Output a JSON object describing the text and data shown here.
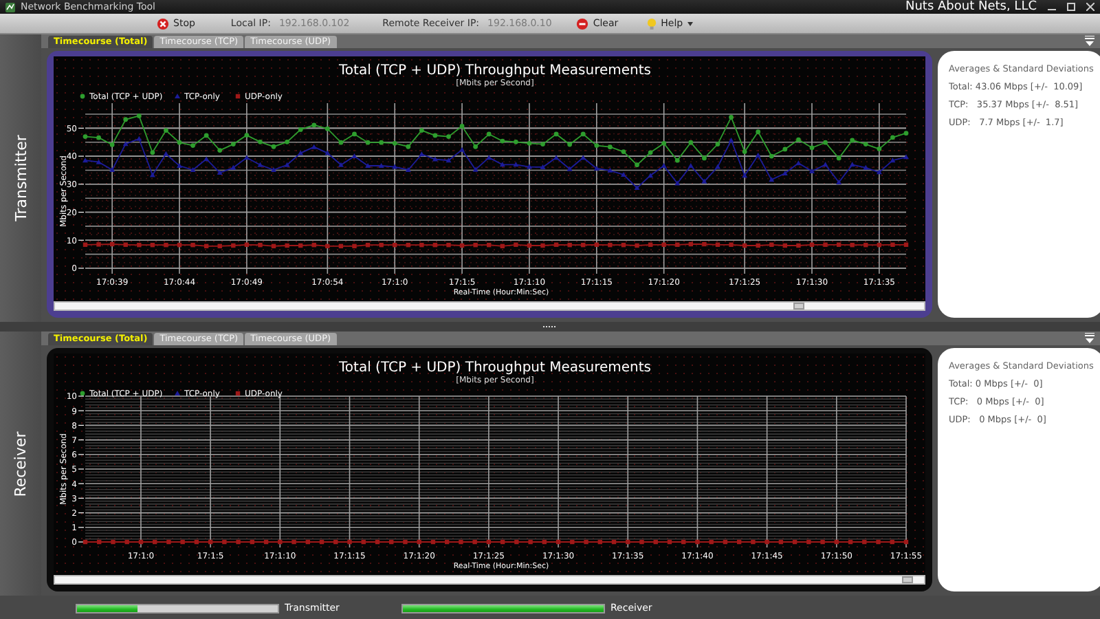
{
  "window": {
    "title": "Network Benchmarking Tool",
    "company": "Nuts About Nets, LLC"
  },
  "toolbar": [
    {
      "kind": "stop",
      "label": "Stop"
    },
    {
      "kind": "label",
      "label": "Local IP:"
    },
    {
      "kind": "value",
      "label": "192.168.0.102"
    },
    {
      "kind": "label",
      "label": "Remote Receiver IP:"
    },
    {
      "kind": "value",
      "label": "192.168.0.10"
    },
    {
      "kind": "clear",
      "label": "Clear"
    },
    {
      "kind": "help",
      "label": "Help"
    }
  ],
  "panels": [
    {
      "name": "Transmitter",
      "selected": true,
      "tabs": [
        {
          "label": "Timecourse (Total)",
          "selected": true
        },
        {
          "label": "Timecourse (TCP)",
          "selected": false
        },
        {
          "label": "Timecourse (UDP)",
          "selected": false
        }
      ],
      "chart_subtitle": "[Mbits per Second]",
      "chart_data": {
        "type": "line",
        "title": "Total (TCP + UDP) Throughput Measurements",
        "xlabel": "Real-Time (Hour:Min:Sec)",
        "ylabel": "Mbits per Second",
        "categories": [
          null,
          null,
          "17:0:39",
          null,
          null,
          null,
          null,
          "17:0:44",
          null,
          null,
          null,
          null,
          "17:0:49",
          null,
          null,
          null,
          null,
          null,
          "17:0:54",
          null,
          null,
          null,
          null,
          "17:1:0",
          null,
          null,
          null,
          null,
          "17:1:5",
          null,
          null,
          null,
          null,
          "17:1:10",
          null,
          null,
          null,
          null,
          "17:1:15",
          null,
          null,
          null,
          null,
          "17:1:20",
          null,
          null,
          null,
          null,
          null,
          "17:1:25",
          null,
          null,
          null,
          null,
          "17:1:30",
          null,
          null,
          null,
          null,
          "17:1:35",
          null,
          null
        ],
        "ylim": [
          0,
          55
        ],
        "grid": true,
        "legend": true,
        "yticks": [
          0,
          10,
          20,
          30,
          40,
          50
        ],
        "series": [
          {
            "name": "Total (TCP + UDP)",
            "color": "#2e9e2e",
            "marker": "circle",
            "values": [
              47.0,
              46.6,
              44.1,
              53.1,
              54.4,
              41.3,
              49.2,
              44.9,
              43.8,
              47.4,
              42.1,
              44.3,
              47.5,
              45.1,
              43.4,
              45.1,
              49.5,
              51.1,
              49.8,
              44.9,
              47.9,
              44.9,
              44.9,
              44.6,
              43.4,
              49.2,
              47.4,
              47.0,
              50.7,
              43.4,
              47.9,
              45.4,
              45.1,
              44.6,
              44.3,
              47.9,
              44.2,
              47.9,
              43.8,
              43.3,
              41.6,
              36.9,
              41.3,
              44.6,
              38.5,
              44.9,
              39.3,
              44.3,
              53.9,
              41.6,
              48.7,
              40.0,
              42.5,
              45.9,
              43.0,
              44.9,
              39.3,
              45.7,
              44.3,
              42.6,
              46.7,
              48.2
            ]
          },
          {
            "name": "TCP-only",
            "color": "#1c1c9a",
            "marker": "triangle",
            "values": [
              38.5,
              37.9,
              35.1,
              44.4,
              46.2,
              33.3,
              40.8,
              36.6,
              35.1,
              39.0,
              34.1,
              35.9,
              39.5,
              36.9,
              35.1,
              36.9,
              41.1,
              43.3,
              41.1,
              36.9,
              40.0,
              36.6,
              36.6,
              36.2,
              35.1,
              40.7,
              38.9,
              38.5,
              42.3,
              35.2,
              39.5,
              37.0,
              37.0,
              36.2,
              36.1,
              39.5,
              35.4,
              39.5,
              35.6,
              34.9,
              33.4,
              28.7,
              33.1,
              36.6,
              30.3,
              36.6,
              31.0,
              36.2,
              45.7,
              33.1,
              40.3,
              31.6,
              33.9,
              37.5,
              34.6,
              37.0,
              30.7,
              37.0,
              35.9,
              34.3,
              38.5,
              39.7
            ]
          },
          {
            "name": "UDP-only",
            "color": "#a01818",
            "marker": "square",
            "values": [
              8.4,
              8.5,
              8.6,
              8.4,
              8.3,
              8.3,
              8.3,
              8.3,
              8.3,
              7.9,
              7.9,
              8.1,
              8.4,
              8.3,
              7.9,
              8.1,
              8.1,
              8.3,
              7.9,
              7.9,
              7.9,
              8.3,
              8.3,
              8.3,
              8.3,
              8.3,
              8.3,
              8.3,
              8.1,
              8.3,
              8.3,
              7.9,
              8.4,
              8.1,
              8.1,
              8.4,
              8.3,
              8.3,
              8.4,
              8.3,
              8.3,
              8.1,
              8.4,
              8.4,
              8.4,
              8.6,
              8.6,
              8.4,
              8.4,
              8.1,
              8.1,
              8.4,
              8.1,
              8.1,
              8.4,
              8.4,
              8.4,
              8.3,
              8.3,
              8.3,
              8.4,
              8.4
            ]
          }
        ]
      },
      "stats": {
        "title": "Averages & Standard Deviations",
        "lines": [
          "Total: 43.06 Mbps [+/-  10.09]",
          "TCP:   35.37 Mbps [+/-  8.51]",
          "UDP:   7.7 Mbps [+/-  1.7]"
        ]
      }
    },
    {
      "name": "Receiver",
      "selected": false,
      "tabs": [
        {
          "label": "Timecourse (Total)",
          "selected": true
        },
        {
          "label": "Timecourse (TCP)",
          "selected": false
        },
        {
          "label": "Timecourse (UDP)",
          "selected": false
        }
      ],
      "chart_subtitle": "[Mbits per Second]",
      "chart_data": {
        "type": "line",
        "title": "Total (TCP + UDP) Throughput Measurements",
        "xlabel": "Real-Time (Hour:Min:Sec)",
        "ylabel": "Mbits per Second",
        "categories": [
          null,
          null,
          null,
          null,
          "17:1:0",
          null,
          null,
          null,
          null,
          "17:1:5",
          null,
          null,
          null,
          null,
          "17:1:10",
          null,
          null,
          null,
          null,
          "17:1:15",
          null,
          null,
          null,
          null,
          "17:1:20",
          null,
          null,
          null,
          null,
          "17:1:25",
          null,
          null,
          null,
          null,
          "17:1:30",
          null,
          null,
          null,
          null,
          "17:1:35",
          null,
          null,
          null,
          null,
          "17:1:40",
          null,
          null,
          null,
          null,
          "17:1:45",
          null,
          null,
          null,
          null,
          "17:1:50",
          null,
          null,
          null,
          null,
          "17:1:55"
        ],
        "ylim": [
          0,
          10
        ],
        "grid": true,
        "legend": true,
        "yticks": [
          0,
          1,
          2,
          3,
          4,
          5,
          6,
          7,
          8,
          9,
          10
        ],
        "series": [
          {
            "name": "Total (TCP + UDP)",
            "color": "#2e9e2e",
            "marker": "circle",
            "values": [
              null,
              null,
              null,
              null,
              null,
              null,
              null,
              null,
              null,
              null,
              null,
              null,
              null,
              null,
              null,
              null,
              null,
              null,
              null,
              null,
              null,
              null,
              null,
              null,
              null,
              null,
              null,
              null,
              null,
              null,
              null,
              null,
              null,
              null,
              null,
              null,
              null,
              null,
              null,
              null,
              null,
              null,
              null,
              null,
              null,
              null,
              null,
              null,
              null,
              null,
              null,
              null,
              null,
              null,
              null,
              null,
              null,
              null,
              null,
              null
            ]
          },
          {
            "name": "TCP-only",
            "color": "#1c1c9a",
            "marker": "triangle",
            "values": [
              null,
              null,
              null,
              null,
              null,
              null,
              null,
              null,
              null,
              null,
              null,
              null,
              null,
              null,
              null,
              null,
              null,
              null,
              null,
              null,
              null,
              null,
              null,
              null,
              null,
              null,
              null,
              null,
              null,
              null,
              null,
              null,
              null,
              null,
              null,
              null,
              null,
              null,
              null,
              null,
              null,
              null,
              null,
              null,
              null,
              null,
              null,
              null,
              null,
              null,
              null,
              null,
              null,
              null,
              null,
              null,
              null,
              null,
              null,
              null
            ]
          },
          {
            "name": "UDP-only",
            "color": "#a01818",
            "marker": "square",
            "values": [
              0,
              0,
              0,
              0,
              0,
              0,
              0,
              0,
              0,
              0,
              0,
              0,
              0,
              0,
              0,
              0,
              0,
              0,
              0,
              0,
              0,
              0,
              0,
              0,
              0,
              0,
              0,
              0,
              0,
              0,
              0,
              0,
              0,
              0,
              0,
              0,
              0,
              0,
              0,
              0,
              0,
              0,
              0,
              0,
              0,
              0,
              0,
              0,
              0,
              0,
              0,
              0,
              0,
              0,
              0,
              0,
              0,
              0,
              0,
              0
            ]
          }
        ]
      },
      "stats": {
        "title": "Averages & Standard Deviations",
        "lines": [
          "Total: 0 Mbps [+/-  0]",
          "TCP:   0 Mbps [+/-  0]",
          "UDP:   0 Mbps [+/-  0]"
        ]
      }
    }
  ],
  "status_bar": [
    {
      "label": "Transmitter",
      "level": 0.3
    },
    {
      "label": "Receiver",
      "level": 1
    }
  ]
}
